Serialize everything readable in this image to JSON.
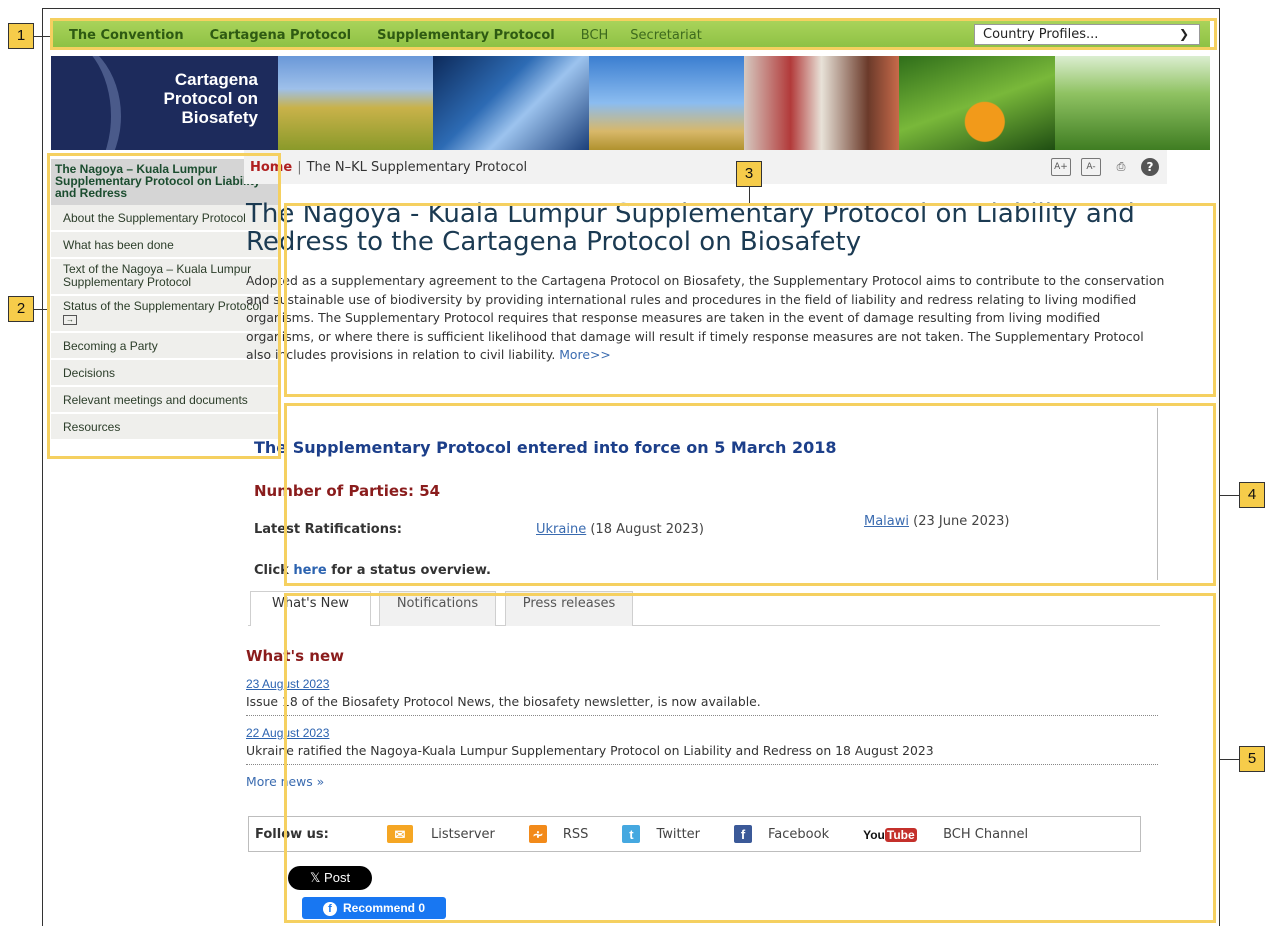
{
  "topnav": {
    "items": [
      "The Convention",
      "Cartagena Protocol",
      "Supplementary Protocol",
      "BCH",
      "Secretariat"
    ],
    "country_select": "Country Profiles..."
  },
  "banner": {
    "logo_line1": "Cartagena",
    "logo_line2": "Protocol on",
    "logo_line3": "Biosafety"
  },
  "sidebar": {
    "title": "The Nagoya – Kuala Lumpur Supplementary Protocol on Liability and Redress",
    "items": [
      "About the Supplementary Protocol",
      "What has been done",
      "Text of the Nagoya – Kuala Lumpur Supplementary Protocol",
      "Status of the Supplementary Protocol",
      "Becoming a Party",
      "Decisions",
      "Relevant meetings and documents",
      "Resources"
    ]
  },
  "breadcrumb": {
    "home": "Home",
    "separator": "|",
    "current": "The N–KL Supplementary Protocol"
  },
  "tools": [
    "zoom-in-icon",
    "zoom-out-icon",
    "print-icon",
    "help-icon"
  ],
  "intro": {
    "title": "The Nagoya - Kuala Lumpur Supplementary Protocol on Liability and Redress to the Cartagena Protocol on Biosafety",
    "body": "Adopted as a supplementary agreement to the Cartagena Protocol on Biosafety, the Supplementary Protocol aims to contribute to the conservation and sustainable use of biodiversity by providing international rules and procedures in the field of liability and redress relating to living modified organisms. The Supplementary Protocol requires that response measures are taken in the event of damage resulting from living modified organisms, or where there is sufficient likelihood that damage will result if timely response measures are not taken. The Supplementary Protocol also includes provisions in relation to civil liability.",
    "more": "More>>"
  },
  "status": {
    "entered": "The Supplementary Protocol entered into force on 5 March 2018",
    "parties": "Number of Parties: 54",
    "latest_label": "Latest Ratifications:",
    "ratifications": [
      {
        "country": "Ukraine",
        "date": "(18 August 2023)"
      },
      {
        "country": "Malawi",
        "date": "(23 June 2023)"
      }
    ],
    "click_pre": "Click",
    "click_link": "here",
    "click_post": "for a status overview."
  },
  "tabs": [
    "What's New",
    "Notifications",
    "Press releases"
  ],
  "news": {
    "heading": "What's new",
    "items": [
      {
        "date": "23 August 2023",
        "text": "Issue 18 of the Biosafety Protocol News, the biosafety newsletter, is now available."
      },
      {
        "date": "22 August 2023",
        "text": "Ukraine ratified the Nagoya-Kuala Lumpur Supplementary Protocol on Liability and Redress on 18 August 2023"
      }
    ],
    "more": "More news »"
  },
  "follow": {
    "label": "Follow us:",
    "items": [
      "Listserver",
      "RSS",
      "Twitter",
      "Facebook",
      "BCH Channel"
    ]
  },
  "social": {
    "x_post": "Post",
    "recommend": "Recommend 0"
  },
  "callouts": [
    "1",
    "2",
    "3",
    "4",
    "5"
  ],
  "colors": {
    "highlight": "#f5d060",
    "nav_green": "#8cc043",
    "title_blue": "#1c3f8a",
    "dark_red": "#8a1c1c"
  }
}
